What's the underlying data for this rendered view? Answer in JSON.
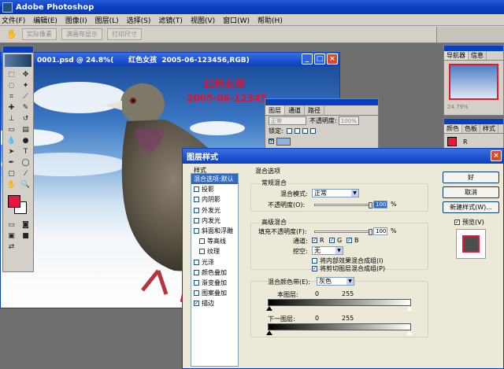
{
  "app": {
    "title": "Adobe Photoshop"
  },
  "menu": [
    "文件(F)",
    "编辑(E)",
    "图像(I)",
    "图层(L)",
    "选择(S)",
    "滤镜(T)",
    "视图(V)",
    "窗口(W)",
    "帮助(H)"
  ],
  "options": {
    "buttons": [
      "实际像素",
      "满画布显示",
      "打印尺寸"
    ]
  },
  "document": {
    "title": "0001.psd @ 24.8%(      红色女孩  2005-06-123456,RGB)",
    "canvas_text_1": "红色女孩",
    "canvas_text_2": "2005-06-12345"
  },
  "layers_panel": {
    "tabs": [
      "图层",
      "通道",
      "路径"
    ],
    "blend": "正常",
    "opacity_label": "不透明度:",
    "opacity": "100%",
    "lock_label": "锁定:"
  },
  "navigator_panel": {
    "tabs": [
      "导航器",
      "信息"
    ],
    "zoom": "24.79%"
  },
  "color_panel": {
    "tabs": [
      "颜色",
      "色板",
      "样式"
    ],
    "channel": "R"
  },
  "dialog": {
    "title": "图层样式",
    "styles_header": "样式",
    "styles": [
      {
        "label": "混合选项:默认",
        "checked": false,
        "selected": true,
        "checkbox": false
      },
      {
        "label": "投影",
        "checked": false
      },
      {
        "label": "内阴影",
        "checked": false
      },
      {
        "label": "外发光",
        "checked": false
      },
      {
        "label": "内发光",
        "checked": false
      },
      {
        "label": "斜面和浮雕",
        "checked": false
      },
      {
        "label": "等高线",
        "checked": false,
        "indent": true
      },
      {
        "label": "纹理",
        "checked": false,
        "indent": true
      },
      {
        "label": "光泽",
        "checked": false
      },
      {
        "label": "颜色叠加",
        "checked": false
      },
      {
        "label": "渐变叠加",
        "checked": false
      },
      {
        "label": "图案叠加",
        "checked": false
      },
      {
        "label": "描边",
        "checked": true
      }
    ],
    "blend_options_title": "混合选项",
    "general_title": "常规混合",
    "blend_mode_label": "混合模式:",
    "blend_mode": "正常",
    "opacity_label": "不透明度(O):",
    "opacity_value": "100",
    "percent": "%",
    "advanced_title": "高级混合",
    "fill_opacity_label": "填充不透明度(F):",
    "fill_opacity_value": "100",
    "channels_label": "通道:",
    "channels": [
      "R",
      "G",
      "B"
    ],
    "knockout_label": "挖空:",
    "knockout_value": "无",
    "option_1": "将内部效果混合成组(I)",
    "option_2": "将剪切图层混合成组(P)",
    "blend_if_label": "混合颜色带(E):",
    "blend_if_value": "灰色",
    "this_layer_label": "本图层:",
    "this_layer_min": "0",
    "this_layer_max": "255",
    "underlying_label": "下一图层:",
    "underlying_min": "0",
    "underlying_max": "255",
    "ok": "好",
    "cancel": "取消",
    "new_style": "新建样式(W)...",
    "preview_label": "预览(V)"
  }
}
